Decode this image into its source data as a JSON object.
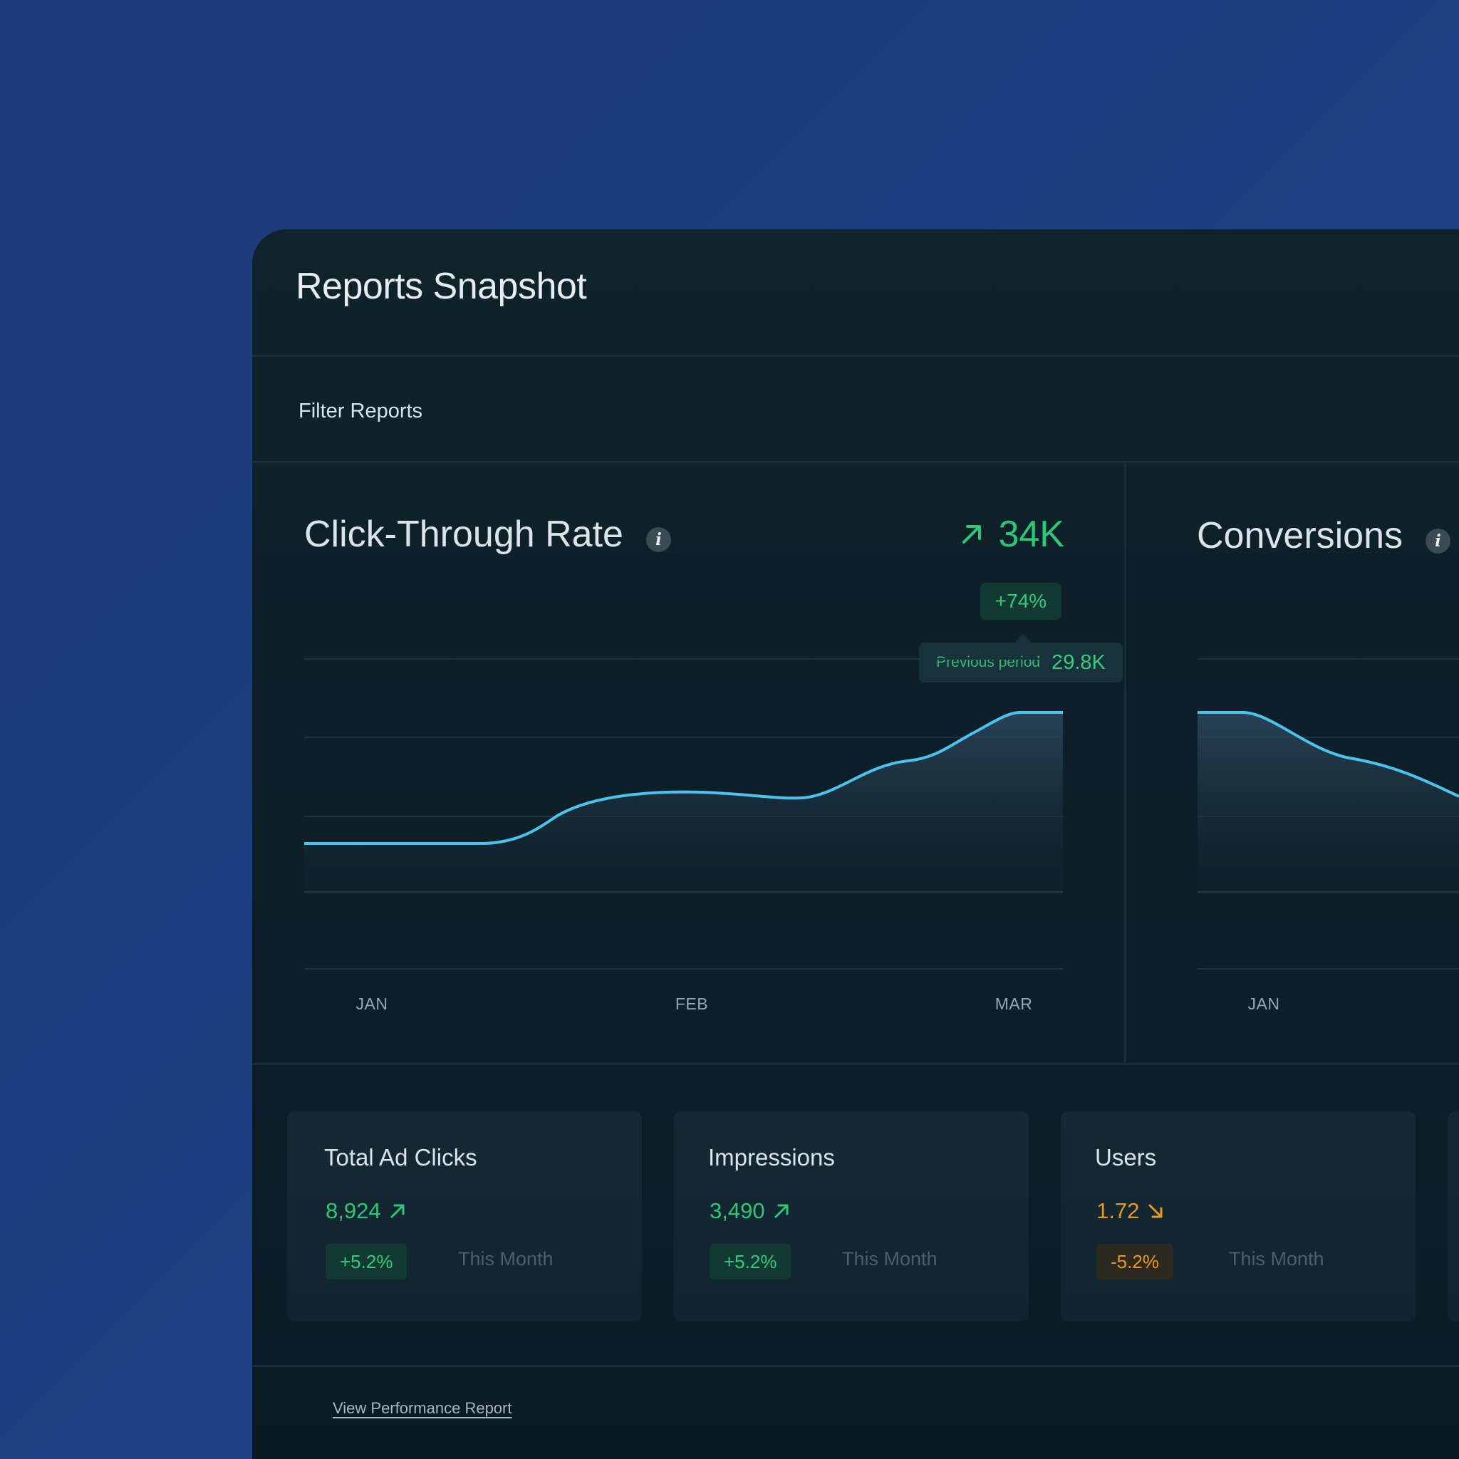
{
  "page": {
    "title": "Reports Snapshot"
  },
  "filter": {
    "label": "Filter Reports"
  },
  "ctr_card": {
    "title": "Click-Through Rate",
    "headline_value": "34K",
    "change_pill": "+74%",
    "tooltip_label": "Previous period",
    "tooltip_value": "29.8K",
    "months": [
      "JAN",
      "FEB",
      "MAR"
    ]
  },
  "conversions_card": {
    "title": "Conversions",
    "months": [
      "JAN"
    ]
  },
  "stats": [
    {
      "title": "Total Ad Clicks",
      "value": "8,924",
      "trend": "up",
      "change": "+5.2%",
      "period": "This Month"
    },
    {
      "title": "Impressions",
      "value": "3,490",
      "trend": "up",
      "change": "+5.2%",
      "period": "This Month"
    },
    {
      "title": "Users",
      "value": "1.72",
      "trend": "down",
      "change": "-5.2%",
      "period": "This Month"
    }
  ],
  "footer": {
    "link": "View Performance Report"
  },
  "colors": {
    "background": "#1c3a78",
    "panel": "#0f232b",
    "line": "#4cc3ee",
    "positive": "#2ec77a",
    "negative": "#e8981a"
  },
  "icons": {
    "info": "info-icon",
    "trend_up": "arrow-up-right-icon",
    "trend_down": "arrow-down-right-icon"
  }
}
